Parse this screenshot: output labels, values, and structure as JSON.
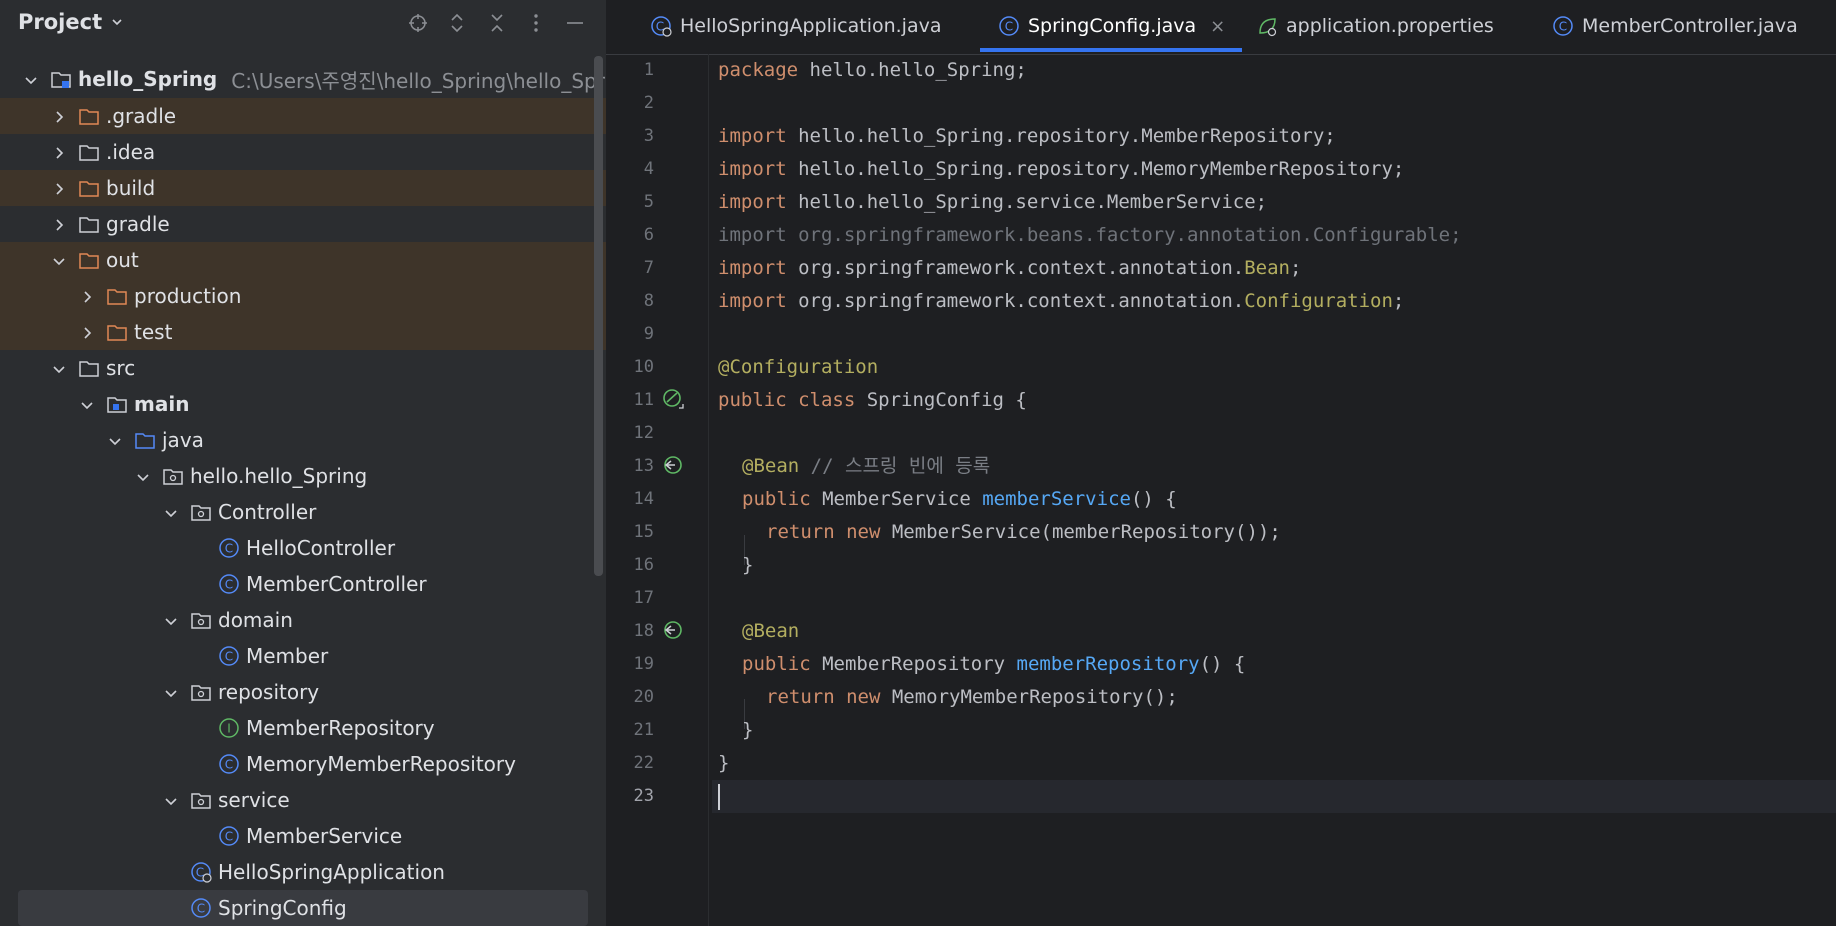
{
  "project_panel": {
    "title": "Project",
    "root": {
      "name": "hello_Spring",
      "path": "C:\\Users\\주영진\\hello_Spring\\hello_Spring"
    },
    "items": [
      {
        "label": ".gradle"
      },
      {
        "label": ".idea"
      },
      {
        "label": "build"
      },
      {
        "label": "gradle"
      },
      {
        "label": "out"
      },
      {
        "label": "production"
      },
      {
        "label": "test"
      },
      {
        "label": "src"
      },
      {
        "label": "main"
      },
      {
        "label": "java"
      },
      {
        "label": "hello.hello_Spring"
      },
      {
        "label": "Controller"
      },
      {
        "label": "HelloController"
      },
      {
        "label": "MemberController"
      },
      {
        "label": "domain"
      },
      {
        "label": "Member"
      },
      {
        "label": "repository"
      },
      {
        "label": "MemberRepository"
      },
      {
        "label": "MemoryMemberRepository"
      },
      {
        "label": "service"
      },
      {
        "label": "MemberService"
      },
      {
        "label": "HelloSpringApplication"
      },
      {
        "label": "SpringConfig"
      }
    ]
  },
  "tabs": [
    {
      "label": "HelloSpringApplication.java"
    },
    {
      "label": "SpringConfig.java",
      "close": "×"
    },
    {
      "label": "application.properties"
    },
    {
      "label": "MemberController.java"
    }
  ],
  "editor": {
    "line_numbers": [
      "1",
      "2",
      "3",
      "4",
      "5",
      "6",
      "7",
      "8",
      "9",
      "10",
      "11",
      "12",
      "13",
      "14",
      "15",
      "16",
      "17",
      "18",
      "19",
      "20",
      "21",
      "22",
      "23"
    ],
    "code": {
      "l1_kw": "package",
      "l1_rest": " hello.hello_Spring;",
      "l3_kw": "import",
      "l3_rest": " hello.hello_Spring.repository.MemberRepository;",
      "l4_kw": "import",
      "l4_rest": " hello.hello_Spring.repository.MemoryMemberRepository;",
      "l5_kw": "import",
      "l5_rest": " hello.hello_Spring.service.MemberService;",
      "l6": "import org.springframework.beans.factory.annotation.Configurable;",
      "l7_kw": "import",
      "l7_rest": " org.springframework.context.annotation.",
      "l7_ann": "Bean",
      "l7_end": ";",
      "l8_kw": "import",
      "l8_rest": " org.springframework.context.annotation.",
      "l8_ann": "Configuration",
      "l8_end": ";",
      "l10": "@Configuration",
      "l11_kw": "public class",
      "l11_rest": " SpringConfig {",
      "l13_ann": "@Bean",
      "l13_cm": " // 스프링 빈에 등록",
      "l14_kw": "public",
      "l14_rest": " MemberService ",
      "l14_fn": "memberService",
      "l14_end": "() {",
      "l15_kw": "return new",
      "l15_rest": " MemberService(memberRepository());",
      "l16": "}",
      "l18_ann": "@Bean",
      "l19_kw": "public",
      "l19_rest": " MemberRepository ",
      "l19_fn": "memberRepository",
      "l19_end": "() {",
      "l20_kw": "return new",
      "l20_rest": " MemoryMemberRepository();",
      "l21": "}",
      "l22": "}"
    }
  }
}
